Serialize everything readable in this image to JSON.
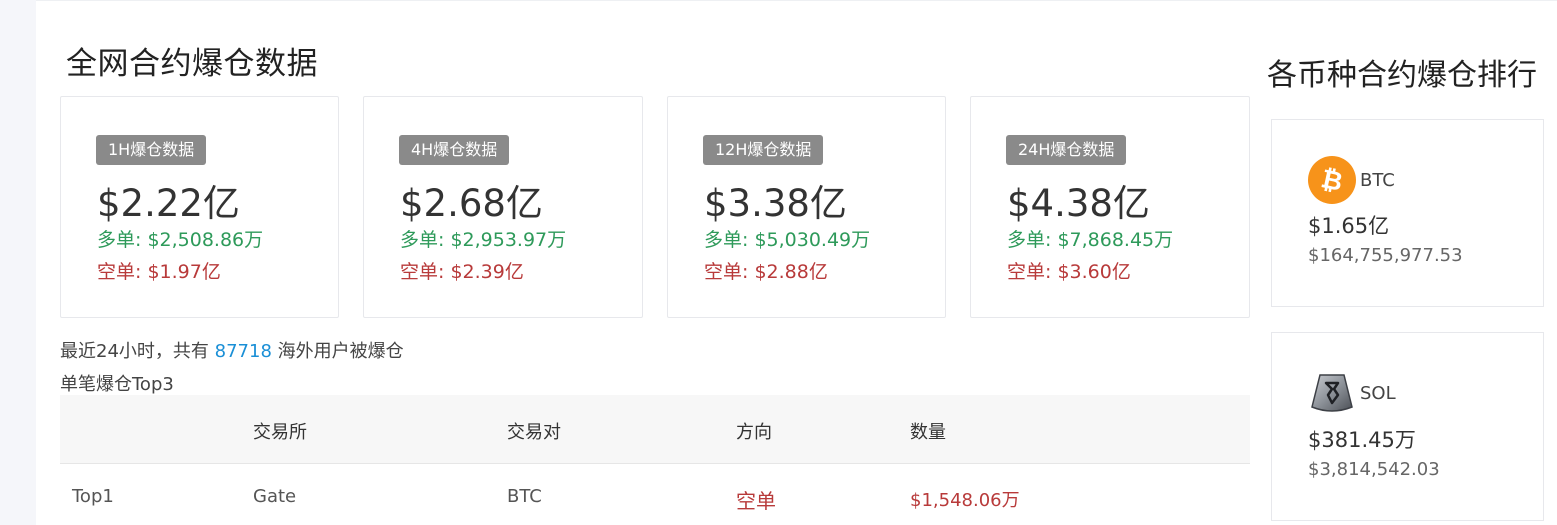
{
  "page": {
    "title": "全网合约爆仓数据",
    "ranking_title": "各币种合约爆仓排行"
  },
  "cards": [
    {
      "badge": "1H爆仓数据",
      "total": "$2.22亿",
      "long": "多单: $2,508.86万",
      "short": "空单: $1.97亿"
    },
    {
      "badge": "4H爆仓数据",
      "total": "$2.68亿",
      "long": "多单: $2,953.97万",
      "short": "空单: $2.39亿"
    },
    {
      "badge": "12H爆仓数据",
      "total": "$3.38亿",
      "long": "多单: $5,030.49万",
      "short": "空单: $2.88亿"
    },
    {
      "badge": "24H爆仓数据",
      "total": "$4.38亿",
      "long": "多单: $7,868.45万",
      "short": "空单: $3.60亿"
    }
  ],
  "summary": {
    "prefix": "最近24小时，共有",
    "count": "87718",
    "suffix": "海外用户被爆仓"
  },
  "top3": {
    "title": "单笔爆仓Top3",
    "headers": [
      "",
      "交易所",
      "交易对",
      "方向",
      "数量"
    ],
    "rows": [
      [
        "Top1",
        "Gate",
        "BTC",
        "空单",
        "$1,548.06万"
      ]
    ]
  },
  "coins": [
    {
      "name": "BTC",
      "amount": "$1.65亿",
      "detail": "$164,755,977.53",
      "icon": "bitcoin-icon",
      "color": "#f7931a"
    },
    {
      "name": "SOL",
      "amount": "$381.45万",
      "detail": "$3,814,542.03",
      "icon": "sol-rune-icon",
      "color": "#7a7f87"
    }
  ],
  "colors": {
    "long": "#2e9a5a",
    "short": "#b83a3a",
    "count": "#1a8fd6",
    "badge": "#8a8a8a"
  }
}
